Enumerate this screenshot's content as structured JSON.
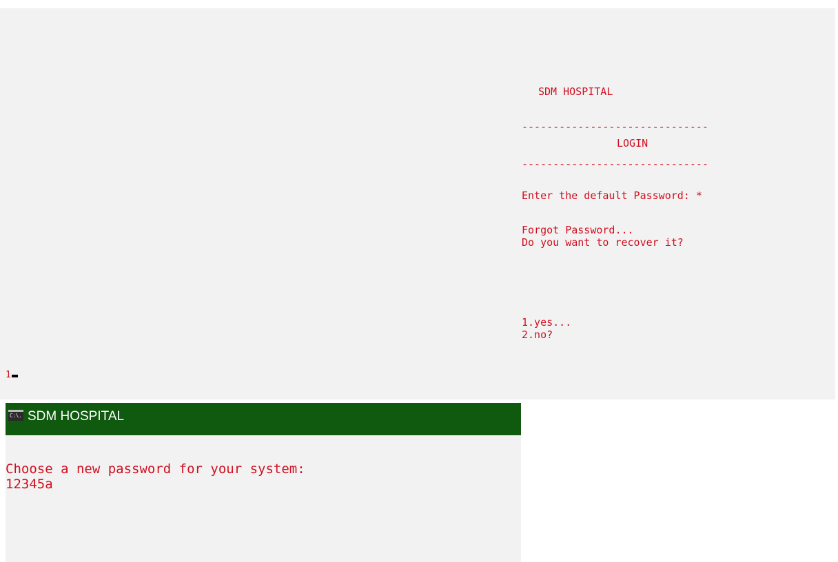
{
  "console1": {
    "hospital_title": "SDM HOSPITAL",
    "separator_top": "------------------------------",
    "login_heading": "LOGIN",
    "separator_bottom": "------------------------------",
    "password_prompt": "Enter the default Password: *",
    "forgot_text": "Forgot Password...",
    "recover_question": "Do you want to recover it?",
    "option_yes": "1.yes...",
    "option_no": "2.no?",
    "typed_input": "1"
  },
  "console2": {
    "window_title": "SDM HOSPITAL",
    "icon": "cmd-icon",
    "icon_label": "C:\\.",
    "choose_prompt": "Choose a new password for your system:",
    "new_password_value": "12345a"
  },
  "colors": {
    "console_text": "#d01020",
    "console_background": "#f2f2f2",
    "titlebar_background": "#0f5a0f",
    "titlebar_text": "#ffffff"
  }
}
